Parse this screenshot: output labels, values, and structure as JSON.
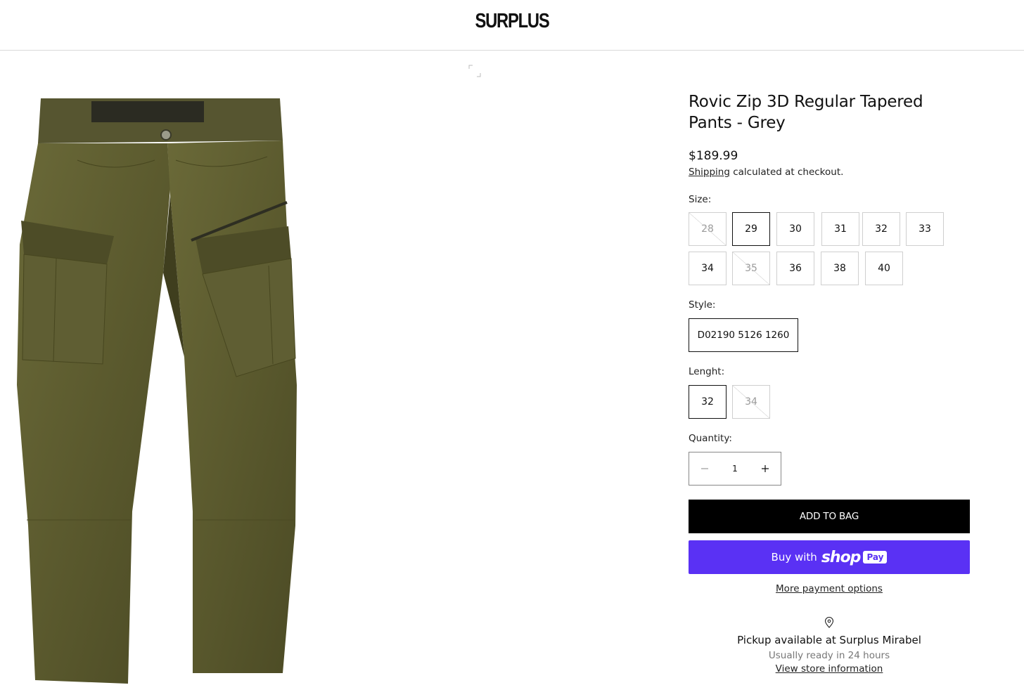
{
  "header": {
    "logo": "SURPLUS"
  },
  "gallery": {
    "zoom_icon": "expand-icon",
    "image_alt": "Olive cargo pants"
  },
  "product": {
    "title": "Rovic Zip 3D Regular Tapered Pants - Grey",
    "price": "$189.99",
    "shipping_link": "Shipping",
    "shipping_text": " calculated at checkout."
  },
  "size": {
    "label": "Size:",
    "options": [
      "28",
      "29",
      "30",
      "31",
      "32",
      "33",
      "34",
      "35",
      "36",
      "38",
      "40"
    ],
    "selected": "29",
    "unavailable": [
      "28",
      "35"
    ]
  },
  "style": {
    "label": "Style:",
    "options": [
      "D02190 5126 1260"
    ],
    "selected": "D02190 5126 1260"
  },
  "length": {
    "label": "Lenght:",
    "options": [
      "32",
      "34"
    ],
    "selected": "32",
    "unavailable": [
      "34"
    ]
  },
  "quantity": {
    "label": "Quantity:",
    "value": "1",
    "minus_icon": "minus-icon",
    "plus_icon": "plus-icon"
  },
  "buttons": {
    "add_to_bag": "ADD TO BAG",
    "buy_with": "Buy with",
    "shop_word": "shop",
    "pay_badge": "Pay",
    "more_payment": "More payment options"
  },
  "pickup": {
    "icon": "map-pin-icon",
    "title": "Pickup available at Surplus Mirabel",
    "subtitle": "Usually ready in 24 hours",
    "link": "View store information"
  },
  "colors": {
    "shop_pay": "#5a31f4",
    "button_dark": "#000000",
    "product": "#5b5a2e"
  }
}
